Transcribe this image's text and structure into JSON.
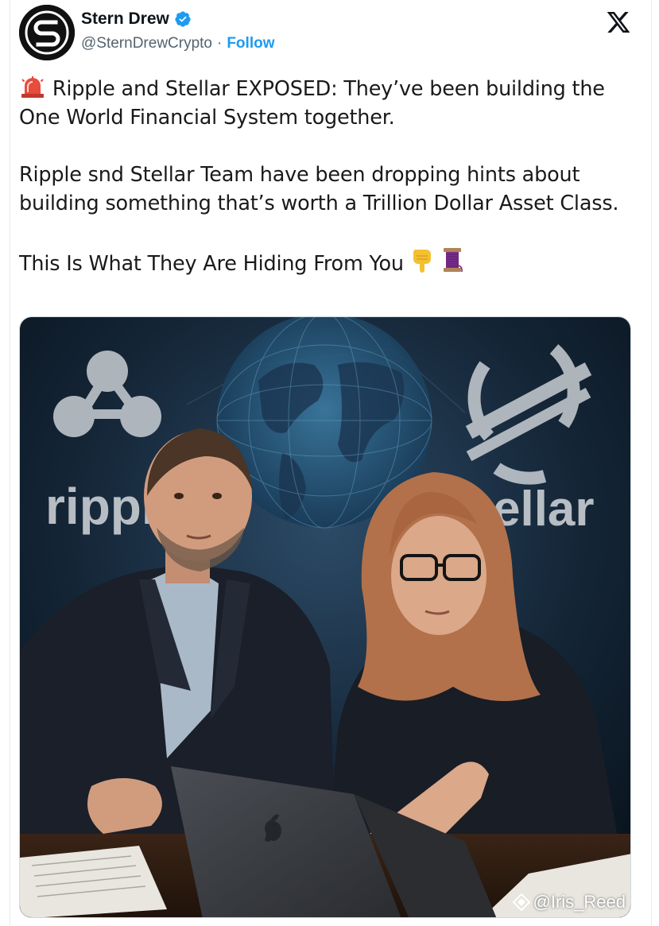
{
  "tweet": {
    "author": {
      "display_name": "Stern Drew",
      "handle": "@SternDrewCrypto",
      "separator": "·",
      "follow_label": "Follow",
      "verified": true,
      "avatar_icon": "stern-drew-logo"
    },
    "platform_icon": "x-logo-icon",
    "text": {
      "line1_emoji": "siren-icon",
      "paragraph1": "Ripple and Stellar EXPOSED: They’ve been building the One World Financial System together.",
      "paragraph2": "Ripple snd Stellar Team have been dropping hints about building something that’s worth a Trillion Dollar Asset Class.",
      "paragraph3": "This Is What They Are Hiding From You",
      "paragraph3_emojis": [
        "pointing-down-icon",
        "thread-icon"
      ]
    },
    "media": {
      "logo_left_text": "ripple",
      "logo_right_text": "stellar",
      "logo_right_visible_text": "ellar",
      "watermark": "@Iris_Reed"
    }
  },
  "colors": {
    "accent": "#1d9bf0",
    "verified": "#1d9bf0",
    "text": "#0f1419",
    "secondary": "#536471"
  }
}
